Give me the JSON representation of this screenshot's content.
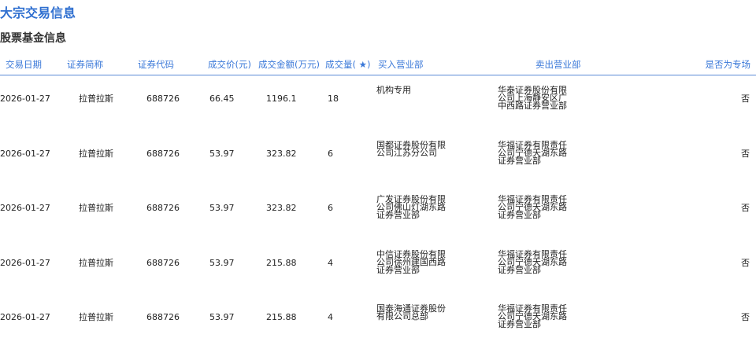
{
  "title": "大宗交易信息",
  "subtitle": "股票基金信息",
  "headers": {
    "date": "交易日期",
    "name": "证券简称",
    "code": "证券代码",
    "price": "成交价(元)",
    "amount": "成交金额(万元)",
    "volume": "成交量( ★)",
    "buyer": "买入营业部",
    "seller": "卖出营业部",
    "special": "是否为专场"
  },
  "rows": [
    {
      "date": "2026-01-27",
      "name": "拉普拉斯",
      "code": "688726",
      "price": "66.45",
      "amount": "1196.1",
      "volume": "18",
      "buyer": "机构专用",
      "seller": "华泰证券股份有限公司上海静安区广中西路证券营业部",
      "special": "否"
    },
    {
      "date": "2026-01-27",
      "name": "拉普拉斯",
      "code": "688726",
      "price": "53.97",
      "amount": "323.82",
      "volume": "6",
      "buyer": "国都证券股份有限公司江苏分公司",
      "seller": "华福证券有限责任公司宁德天湖东路证券营业部",
      "special": "否"
    },
    {
      "date": "2026-01-27",
      "name": "拉普拉斯",
      "code": "688726",
      "price": "53.97",
      "amount": "323.82",
      "volume": "6",
      "buyer": "广发证券股份有限公司佛山灯湖东路证券营业部",
      "seller": "华福证券有限责任公司宁德天湖东路证券营业部",
      "special": "否"
    },
    {
      "date": "2026-01-27",
      "name": "拉普拉斯",
      "code": "688726",
      "price": "53.97",
      "amount": "215.88",
      "volume": "4",
      "buyer": "中信证券股份有限公司徐州建国西路证券营业部",
      "seller": "华福证券有限责任公司宁德天湖东路证券营业部",
      "special": "否"
    },
    {
      "date": "2026-01-27",
      "name": "拉普拉斯",
      "code": "688726",
      "price": "53.97",
      "amount": "215.88",
      "volume": "4",
      "buyer": "国泰海通证券股份有限公司总部",
      "seller": "华福证券有限责任公司宁德天湖东路证券营业部",
      "special": "否"
    }
  ]
}
